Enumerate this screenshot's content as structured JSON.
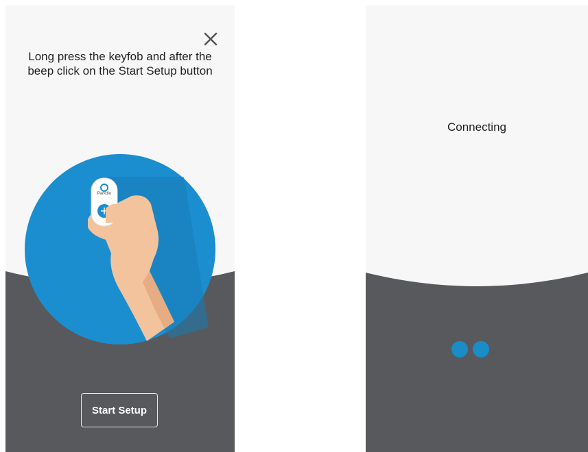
{
  "setup_screen": {
    "close_icon": "close-icon",
    "instruction": "Long press the keyfob and after the beep click on the Start Setup button",
    "keyfob_brand": "Parkdio",
    "start_button_label": "Start Setup",
    "colors": {
      "dark_bg": "#57595c",
      "circle_blue": "#1b8ecf",
      "skin": "#f2c39d"
    }
  },
  "connecting_screen": {
    "status_label": "Connecting",
    "spinner_dot_color": "#1a8cc7"
  }
}
